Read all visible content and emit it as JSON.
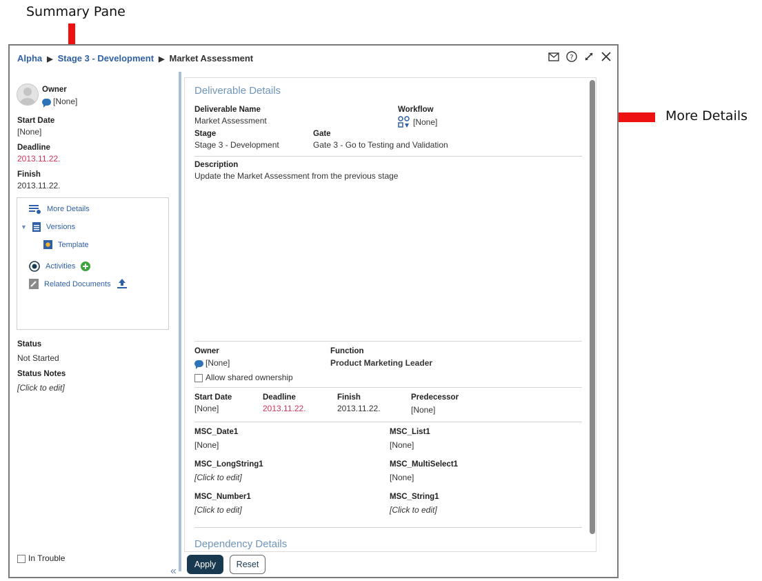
{
  "callouts": {
    "summary_pane": "Summary Pane",
    "more_details": "More Details",
    "arrow_color": "#ee1111"
  },
  "breadcrumb": {
    "root": "Alpha",
    "stage": "Stage 3 - Development",
    "current": "Market Assessment"
  },
  "window_icons": [
    "mail-icon",
    "help-icon",
    "expand-icon",
    "close-icon"
  ],
  "summary": {
    "owner_label": "Owner",
    "owner_value": "[None]",
    "start_date_label": "Start Date",
    "start_date_value": "[None]",
    "deadline_label": "Deadline",
    "deadline_value": "2013.11.22.",
    "finish_label": "Finish",
    "finish_value": "2013.11.22.",
    "nav": {
      "more_details": "More Details",
      "versions": "Versions",
      "template": "Template",
      "activities": "Activities",
      "related_documents": "Related Documents"
    },
    "status_label": "Status",
    "status_value": "Not Started",
    "status_notes_label": "Status Notes",
    "status_notes_value": "[Click to edit]",
    "in_trouble_label": "In Trouble"
  },
  "details": {
    "section_title": "Deliverable Details",
    "deliverable_name_label": "Deliverable Name",
    "deliverable_name_value": "Market Assessment",
    "workflow_label": "Workflow",
    "workflow_value": "[None]",
    "stage_label": "Stage",
    "stage_value": "Stage 3 - Development",
    "gate_label": "Gate",
    "gate_value": "Gate 3 - Go to Testing and Validation",
    "description_label": "Description",
    "description_value": "Update the Market Assessment from the previous stage",
    "owner_label": "Owner",
    "owner_value": "[None]",
    "function_label": "Function",
    "function_value": "Product Marketing Leader",
    "allow_shared_label": "Allow shared ownership",
    "start_date_label": "Start Date",
    "start_date_value": "[None]",
    "deadline_label": "Deadline",
    "deadline_value": "2013.11.22.",
    "finish_label": "Finish",
    "finish_value": "2013.11.22.",
    "predecessor_label": "Predecessor",
    "predecessor_value": "[None]",
    "msc_date1_label": "MSC_Date1",
    "msc_date1_value": "[None]",
    "msc_list1_label": "MSC_List1",
    "msc_list1_value": "[None]",
    "msc_longstring1_label": "MSC_LongString1",
    "msc_longstring1_value": "[Click to edit]",
    "msc_multiselect1_label": "MSC_MultiSelect1",
    "msc_multiselect1_value": "[None]",
    "msc_number1_label": "MSC_Number1",
    "msc_number1_value": "[Click to edit]",
    "msc_string1_label": "MSC_String1",
    "msc_string1_value": "[Click to edit]",
    "dependency_title": "Dependency Details"
  },
  "buttons": {
    "apply": "Apply",
    "reset": "Reset"
  },
  "colors": {
    "link": "#2e5fa8",
    "deadline": "#d0345a",
    "section_title": "#6f95bb",
    "apply_bg": "#18394f"
  }
}
